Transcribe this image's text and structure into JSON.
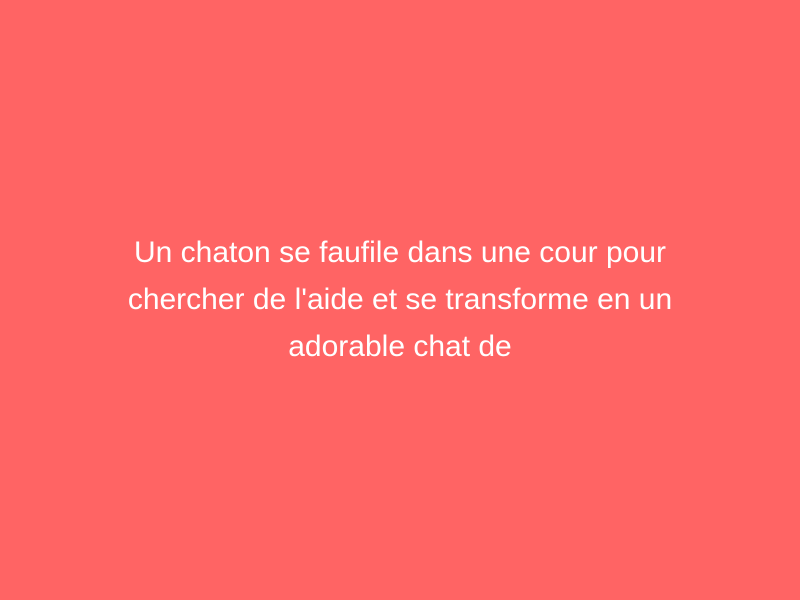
{
  "caption": "Un chaton se faufile dans une cour pour chercher de l'aide et se transforme en un adorable chat de",
  "colors": {
    "background": "#ff6464",
    "text": "#ffffff"
  }
}
